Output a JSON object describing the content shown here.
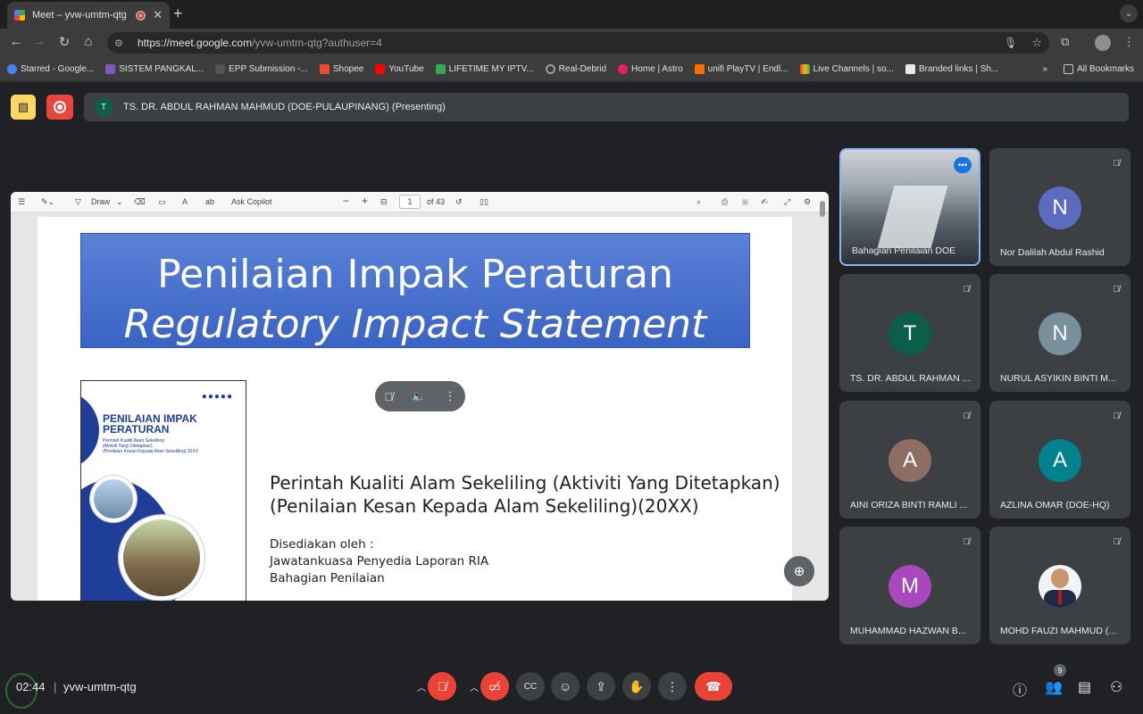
{
  "browser": {
    "tab_title": "Meet – yvw-umtm-qtg",
    "url_host": "https://meet.google.com",
    "url_path": "/yvw-umtm-qtg?authuser=4",
    "bookmarks": [
      "Starred - Google...",
      "SISTEM PANGKAL...",
      "EPP Submission -...",
      "Shopee",
      "YouTube",
      "LIFETIME MY IPTV...",
      "Real-Debrid",
      "Home | Astro",
      "unifi PlayTV | Endl...",
      "Live Channels | so...",
      "Branded links | Sh..."
    ],
    "all_bookmarks": "All Bookmarks"
  },
  "presenter": {
    "initial": "T",
    "text": "TS. DR. ABDUL RAHMAN MAHMUD (DOE-PULAUPINANG) (Presenting)"
  },
  "pdf_toolbar": {
    "draw": "Draw",
    "ask_copilot": "Ask Copilot",
    "page": "1",
    "of_pages": "of 43"
  },
  "slide": {
    "title_ms": "Penilaian Impak Peraturan",
    "title_en": "Regulatory Impact Statement",
    "cover_title": "PENILAIAN IMPAK PERATURAN",
    "cover_sub1": "Perintah Kualiti Alam Sekeliling",
    "cover_sub2": "(Aktiviti Yang Ditetapkan)",
    "cover_sub3": "(Penilaian Kesan Kepada Alam Sekeliling) 20XX",
    "order_line1": "Perintah Kualiti Alam Sekeliling (Aktiviti Yang Ditetapkan)",
    "order_line2": "(Penilaian Kesan Kepada Alam Sekeliling)(20XX)",
    "prepared_by": "Disediakan oleh :",
    "committee": "Jawatankuasa Penyedia Laporan RIA",
    "division": "Bahagian Penilaian"
  },
  "participants": [
    {
      "name": "Bahagian Penilaian DOE",
      "initial": "",
      "color": ""
    },
    {
      "name": "Nor Dalilah Abdul Rashid",
      "initial": "N",
      "color": "#5c6bc0"
    },
    {
      "name": "TS. DR. ABDUL RAHMAN ...",
      "initial": "T",
      "color": "#0b5e4a"
    },
    {
      "name": "NURUL ASYIKIN BINTI M...",
      "initial": "N",
      "color": "#78909c"
    },
    {
      "name": "AINI ORIZA BINTI RAMLI ...",
      "initial": "A",
      "color": "#8d6e63"
    },
    {
      "name": "AZLINA OMAR (DOE-HQ)",
      "initial": "A",
      "color": "#00838f"
    },
    {
      "name": "MUHAMMAD HAZWAN B...",
      "initial": "M",
      "color": "#ab47bc"
    },
    {
      "name": "MOHD FAUZI MAHMUD (...",
      "initial": "",
      "color": ""
    }
  ],
  "bottom": {
    "clock": "02:44",
    "meeting_code": "yvw-umtm-qtg",
    "people_count": "9"
  }
}
